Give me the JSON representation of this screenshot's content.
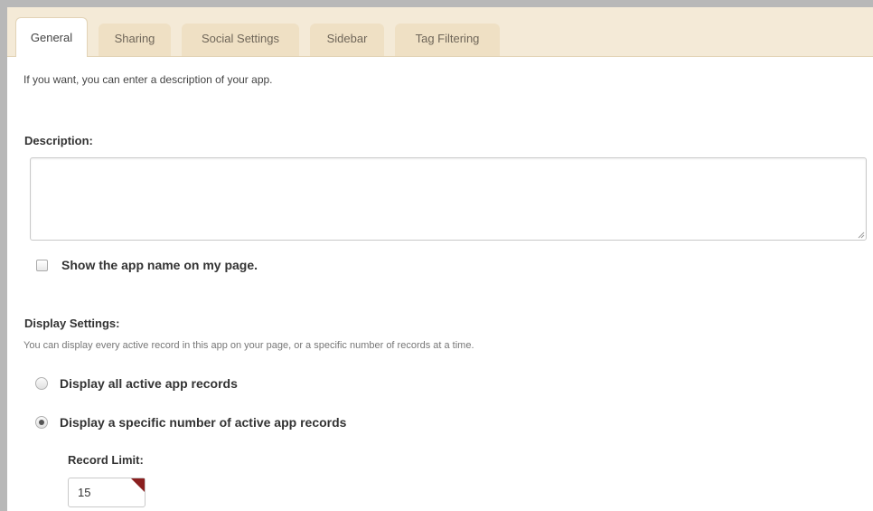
{
  "tabs": [
    {
      "label": "General",
      "active": true
    },
    {
      "label": "Sharing",
      "active": false
    },
    {
      "label": "Social Settings",
      "active": false
    },
    {
      "label": "Sidebar",
      "active": false
    },
    {
      "label": "Tag Filtering",
      "active": false
    }
  ],
  "general": {
    "intro": "If you want, you can enter a description of your app.",
    "description_label": "Description:",
    "description_value": "",
    "show_name_label": "Show the app name on my page.",
    "show_name_checked": false
  },
  "display_settings": {
    "heading": "Display Settings:",
    "subtext": "You can display every active record in this app on your page, or a specific number of records at a time.",
    "options": [
      {
        "label": "Display all active app records",
        "selected": false
      },
      {
        "label": "Display a specific number of active app records",
        "selected": true
      }
    ],
    "record_limit_label": "Record Limit:",
    "record_limit_value": "15"
  },
  "colors": {
    "tabbar_bg": "#f4ead7",
    "tab_bg": "#efe0c4",
    "accent": "#8a1f1f"
  },
  "icons": [
    "resize-grip-icon",
    "required-corner-icon"
  ]
}
